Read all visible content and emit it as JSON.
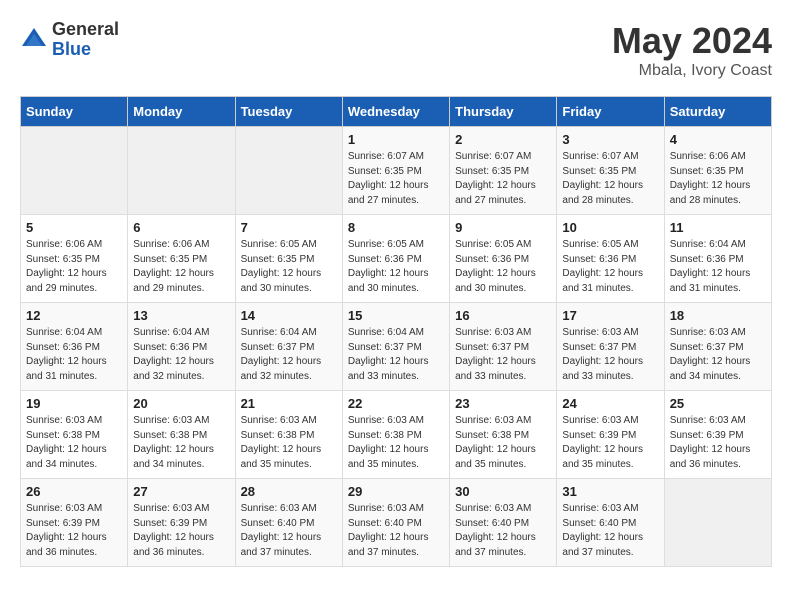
{
  "logo": {
    "general": "General",
    "blue": "Blue"
  },
  "title": "May 2024",
  "location": "Mbala, Ivory Coast",
  "weekdays": [
    "Sunday",
    "Monday",
    "Tuesday",
    "Wednesday",
    "Thursday",
    "Friday",
    "Saturday"
  ],
  "weeks": [
    [
      {
        "day": "",
        "sunrise": "",
        "sunset": "",
        "daylight": ""
      },
      {
        "day": "",
        "sunrise": "",
        "sunset": "",
        "daylight": ""
      },
      {
        "day": "",
        "sunrise": "",
        "sunset": "",
        "daylight": ""
      },
      {
        "day": "1",
        "sunrise": "Sunrise: 6:07 AM",
        "sunset": "Sunset: 6:35 PM",
        "daylight": "Daylight: 12 hours and 27 minutes."
      },
      {
        "day": "2",
        "sunrise": "Sunrise: 6:07 AM",
        "sunset": "Sunset: 6:35 PM",
        "daylight": "Daylight: 12 hours and 27 minutes."
      },
      {
        "day": "3",
        "sunrise": "Sunrise: 6:07 AM",
        "sunset": "Sunset: 6:35 PM",
        "daylight": "Daylight: 12 hours and 28 minutes."
      },
      {
        "day": "4",
        "sunrise": "Sunrise: 6:06 AM",
        "sunset": "Sunset: 6:35 PM",
        "daylight": "Daylight: 12 hours and 28 minutes."
      }
    ],
    [
      {
        "day": "5",
        "sunrise": "Sunrise: 6:06 AM",
        "sunset": "Sunset: 6:35 PM",
        "daylight": "Daylight: 12 hours and 29 minutes."
      },
      {
        "day": "6",
        "sunrise": "Sunrise: 6:06 AM",
        "sunset": "Sunset: 6:35 PM",
        "daylight": "Daylight: 12 hours and 29 minutes."
      },
      {
        "day": "7",
        "sunrise": "Sunrise: 6:05 AM",
        "sunset": "Sunset: 6:35 PM",
        "daylight": "Daylight: 12 hours and 30 minutes."
      },
      {
        "day": "8",
        "sunrise": "Sunrise: 6:05 AM",
        "sunset": "Sunset: 6:36 PM",
        "daylight": "Daylight: 12 hours and 30 minutes."
      },
      {
        "day": "9",
        "sunrise": "Sunrise: 6:05 AM",
        "sunset": "Sunset: 6:36 PM",
        "daylight": "Daylight: 12 hours and 30 minutes."
      },
      {
        "day": "10",
        "sunrise": "Sunrise: 6:05 AM",
        "sunset": "Sunset: 6:36 PM",
        "daylight": "Daylight: 12 hours and 31 minutes."
      },
      {
        "day": "11",
        "sunrise": "Sunrise: 6:04 AM",
        "sunset": "Sunset: 6:36 PM",
        "daylight": "Daylight: 12 hours and 31 minutes."
      }
    ],
    [
      {
        "day": "12",
        "sunrise": "Sunrise: 6:04 AM",
        "sunset": "Sunset: 6:36 PM",
        "daylight": "Daylight: 12 hours and 31 minutes."
      },
      {
        "day": "13",
        "sunrise": "Sunrise: 6:04 AM",
        "sunset": "Sunset: 6:36 PM",
        "daylight": "Daylight: 12 hours and 32 minutes."
      },
      {
        "day": "14",
        "sunrise": "Sunrise: 6:04 AM",
        "sunset": "Sunset: 6:37 PM",
        "daylight": "Daylight: 12 hours and 32 minutes."
      },
      {
        "day": "15",
        "sunrise": "Sunrise: 6:04 AM",
        "sunset": "Sunset: 6:37 PM",
        "daylight": "Daylight: 12 hours and 33 minutes."
      },
      {
        "day": "16",
        "sunrise": "Sunrise: 6:03 AM",
        "sunset": "Sunset: 6:37 PM",
        "daylight": "Daylight: 12 hours and 33 minutes."
      },
      {
        "day": "17",
        "sunrise": "Sunrise: 6:03 AM",
        "sunset": "Sunset: 6:37 PM",
        "daylight": "Daylight: 12 hours and 33 minutes."
      },
      {
        "day": "18",
        "sunrise": "Sunrise: 6:03 AM",
        "sunset": "Sunset: 6:37 PM",
        "daylight": "Daylight: 12 hours and 34 minutes."
      }
    ],
    [
      {
        "day": "19",
        "sunrise": "Sunrise: 6:03 AM",
        "sunset": "Sunset: 6:38 PM",
        "daylight": "Daylight: 12 hours and 34 minutes."
      },
      {
        "day": "20",
        "sunrise": "Sunrise: 6:03 AM",
        "sunset": "Sunset: 6:38 PM",
        "daylight": "Daylight: 12 hours and 34 minutes."
      },
      {
        "day": "21",
        "sunrise": "Sunrise: 6:03 AM",
        "sunset": "Sunset: 6:38 PM",
        "daylight": "Daylight: 12 hours and 35 minutes."
      },
      {
        "day": "22",
        "sunrise": "Sunrise: 6:03 AM",
        "sunset": "Sunset: 6:38 PM",
        "daylight": "Daylight: 12 hours and 35 minutes."
      },
      {
        "day": "23",
        "sunrise": "Sunrise: 6:03 AM",
        "sunset": "Sunset: 6:38 PM",
        "daylight": "Daylight: 12 hours and 35 minutes."
      },
      {
        "day": "24",
        "sunrise": "Sunrise: 6:03 AM",
        "sunset": "Sunset: 6:39 PM",
        "daylight": "Daylight: 12 hours and 35 minutes."
      },
      {
        "day": "25",
        "sunrise": "Sunrise: 6:03 AM",
        "sunset": "Sunset: 6:39 PM",
        "daylight": "Daylight: 12 hours and 36 minutes."
      }
    ],
    [
      {
        "day": "26",
        "sunrise": "Sunrise: 6:03 AM",
        "sunset": "Sunset: 6:39 PM",
        "daylight": "Daylight: 12 hours and 36 minutes."
      },
      {
        "day": "27",
        "sunrise": "Sunrise: 6:03 AM",
        "sunset": "Sunset: 6:39 PM",
        "daylight": "Daylight: 12 hours and 36 minutes."
      },
      {
        "day": "28",
        "sunrise": "Sunrise: 6:03 AM",
        "sunset": "Sunset: 6:40 PM",
        "daylight": "Daylight: 12 hours and 37 minutes."
      },
      {
        "day": "29",
        "sunrise": "Sunrise: 6:03 AM",
        "sunset": "Sunset: 6:40 PM",
        "daylight": "Daylight: 12 hours and 37 minutes."
      },
      {
        "day": "30",
        "sunrise": "Sunrise: 6:03 AM",
        "sunset": "Sunset: 6:40 PM",
        "daylight": "Daylight: 12 hours and 37 minutes."
      },
      {
        "day": "31",
        "sunrise": "Sunrise: 6:03 AM",
        "sunset": "Sunset: 6:40 PM",
        "daylight": "Daylight: 12 hours and 37 minutes."
      },
      {
        "day": "",
        "sunrise": "",
        "sunset": "",
        "daylight": ""
      }
    ]
  ]
}
